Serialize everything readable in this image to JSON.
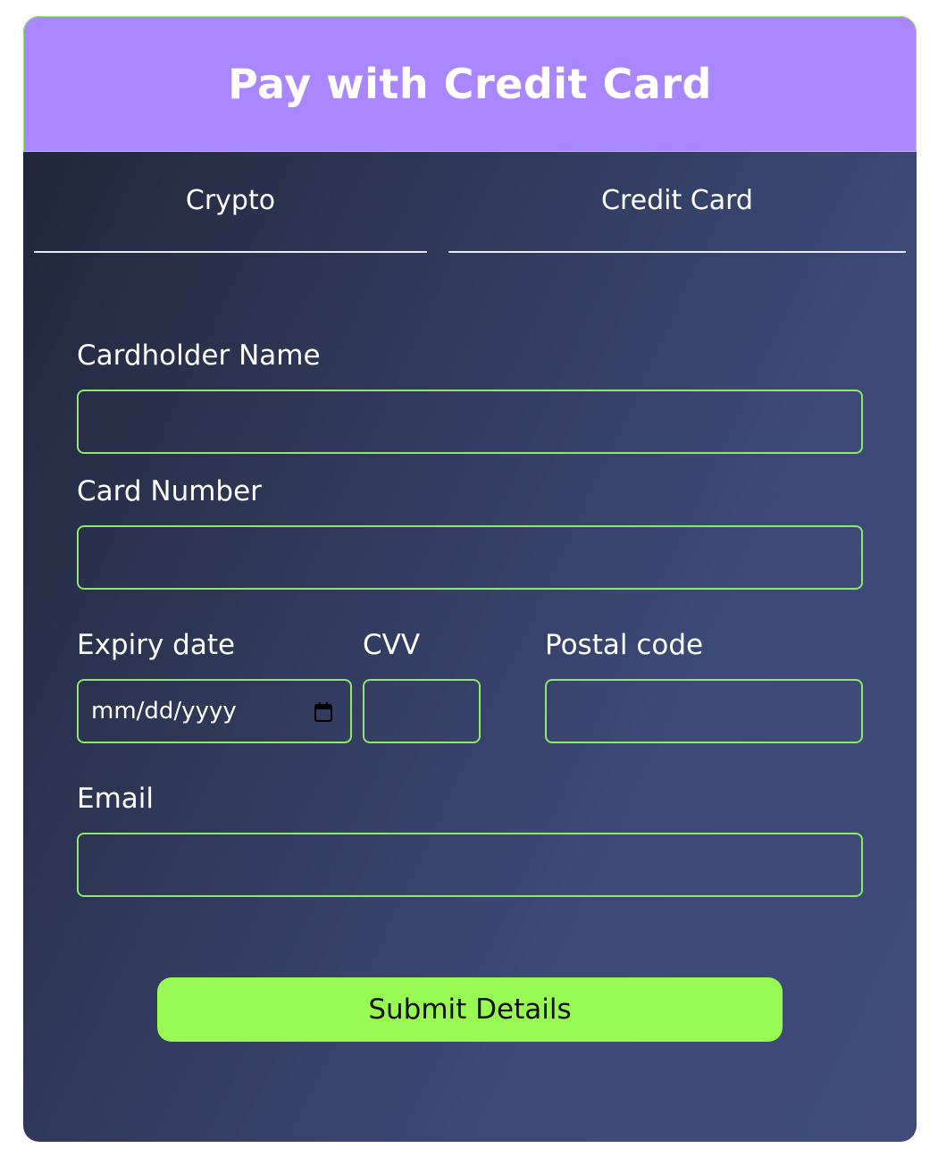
{
  "header": {
    "title": "Pay with Credit Card"
  },
  "tabs": [
    {
      "label": "Crypto"
    },
    {
      "label": "Credit Card"
    }
  ],
  "form": {
    "cardholder_label": "Cardholder Name",
    "cardholder_value": "",
    "card_number_label": "Card Number",
    "card_number_value": "",
    "expiry_label": "Expiry date",
    "expiry_value": "mm/dd/yyyy",
    "cvv_label": "CVV",
    "cvv_value": "",
    "postal_label": "Postal code",
    "postal_value": "",
    "email_label": "Email",
    "email_value": "",
    "submit_label": "Submit Details"
  },
  "icons": {
    "calendar": "calendar-icon"
  },
  "colors": {
    "header_bg": "#a987ff",
    "accent_border": "#8fe86a",
    "submit_bg": "#99f954",
    "panel_dark": "#1f2437",
    "panel_light": "#3f4c7a"
  }
}
